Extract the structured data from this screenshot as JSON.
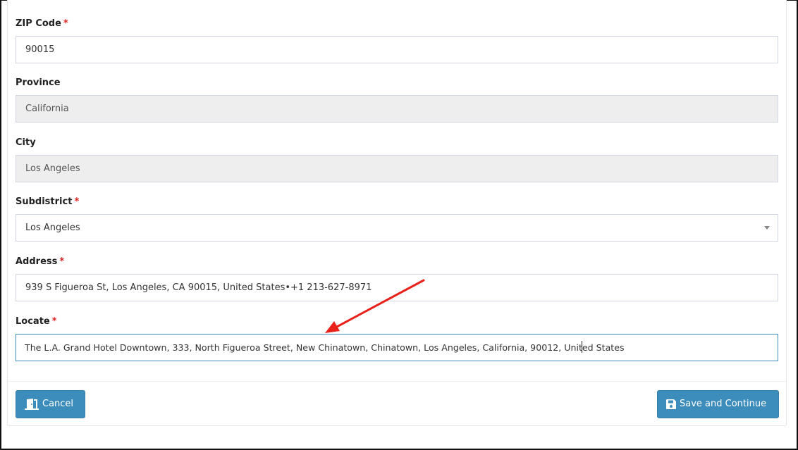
{
  "form": {
    "zip": {
      "label": "ZIP Code",
      "required_mark": "*",
      "value": "90015"
    },
    "province": {
      "label": "Province",
      "value": "California"
    },
    "city": {
      "label": "City",
      "value": "Los Angeles"
    },
    "subdistrict": {
      "label": "Subdistrict",
      "required_mark": "*",
      "selected": "Los Angeles"
    },
    "address": {
      "label": "Address",
      "required_mark": "*",
      "value": "939 S Figueroa St, Los Angeles, CA 90015, United States•+1 213-627-8971"
    },
    "locate": {
      "label": "Locate",
      "required_mark": "*",
      "value_before_cursor": "The L.A. Grand Hotel Downtown, 333, North Figueroa Street, New Chinatown, Chinatown, Los Angeles, California, 90012, Unit",
      "value_after_cursor": "ed States"
    }
  },
  "actions": {
    "cancel_label": "Cancel",
    "save_label": "Save and Continue"
  },
  "colors": {
    "primary_button": "#3c8dbc",
    "required_asterisk": "#dd2222",
    "readonly_background": "#eeeeee",
    "annotation_arrow": "#e8221b"
  },
  "icons": {
    "cancel": "door-exit-icon",
    "save": "floppy-disk-icon",
    "select": "caret-down-icon"
  }
}
